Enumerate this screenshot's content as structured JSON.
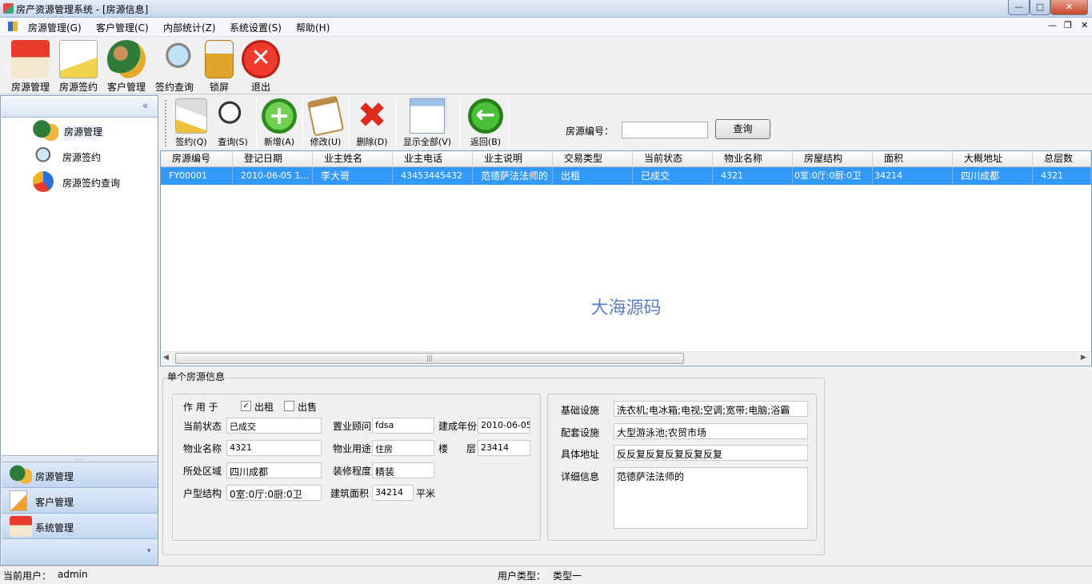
{
  "window": {
    "title": "房产资源管理系统 - [房源信息]"
  },
  "menu": [
    "房源管理(G)",
    "客户管理(C)",
    "内部统计(Z)",
    "系统设置(S)",
    "帮助(H)"
  ],
  "toolbar": [
    "房源管理",
    "房源签约",
    "客户管理",
    "签约查询",
    "锁屏",
    "退出"
  ],
  "tree": [
    "房源管理",
    "房源签约",
    "房源签约查询"
  ],
  "outlook": [
    "房源管理",
    "客户管理",
    "系统管理"
  ],
  "subtoolbar": [
    "签约(Q)",
    "查询(S)",
    "新增(A)",
    "修改(U)",
    "删除(D)",
    "显示全部(V)",
    "返回(B)"
  ],
  "search": {
    "label": "房源编号：",
    "value": "",
    "button": "查询"
  },
  "grid": {
    "columns": [
      "房源编号",
      "登记日期",
      "业主姓名",
      "业主电话",
      "业主说明",
      "交易类型",
      "当前状态",
      "物业名称",
      "房屋结构",
      "面积",
      "大概地址",
      "总层数"
    ],
    "rows": [
      [
        "FY00001",
        "2010-06-05 1...",
        "李大哥",
        "43453445432",
        "范德萨法法师的",
        "出租",
        "已成交",
        "4321",
        "0室:0厅:0厨:0卫",
        "34214",
        "四川成都",
        "4321"
      ]
    ]
  },
  "watermark": "大海源码",
  "detail": {
    "group_title": "单个房源信息",
    "usage_label": "作 用 于",
    "rent_label": "出租",
    "rent_checked": true,
    "sale_label": "出售",
    "sale_checked": false,
    "status_label": "当前状态",
    "status": "已成交",
    "agent_label": "置业顾问",
    "agent": "fdsa",
    "year_label": "建成年份",
    "year": "2010-06-05",
    "property_label": "物业名称",
    "property": "4321",
    "use_label": "物业用途",
    "use": "住房",
    "building_label": "楼",
    "floor_label": "层",
    "floor": "23414",
    "region_label": "所处区域",
    "region": "四川成都",
    "decor_label": "装修程度",
    "decor": "精装",
    "layout_label": "户型结构",
    "layout": "0室:0厅:0厨:0卫",
    "area_label": "建筑面积",
    "area": "34214",
    "area_unit": "平米",
    "infra_label": "基础设施",
    "infra": "洗衣机;电冰箱;电视;空调;宽带;电脑;浴霸",
    "facility_label": "配套设施",
    "facility": "大型游泳池;农贸市场",
    "address_label": "具体地址",
    "address": "反反复反复反复反复反复",
    "detail_label": "详细信息",
    "detail_text": "范德萨法法师的"
  },
  "status": {
    "user_label": "当前用户：",
    "user": "admin",
    "type_label": "用户类型：",
    "type": "类型一"
  },
  "colors": {
    "selection": "#3399ff",
    "watermark": "#5b7fc4",
    "outlook": "#c2d6f0"
  }
}
